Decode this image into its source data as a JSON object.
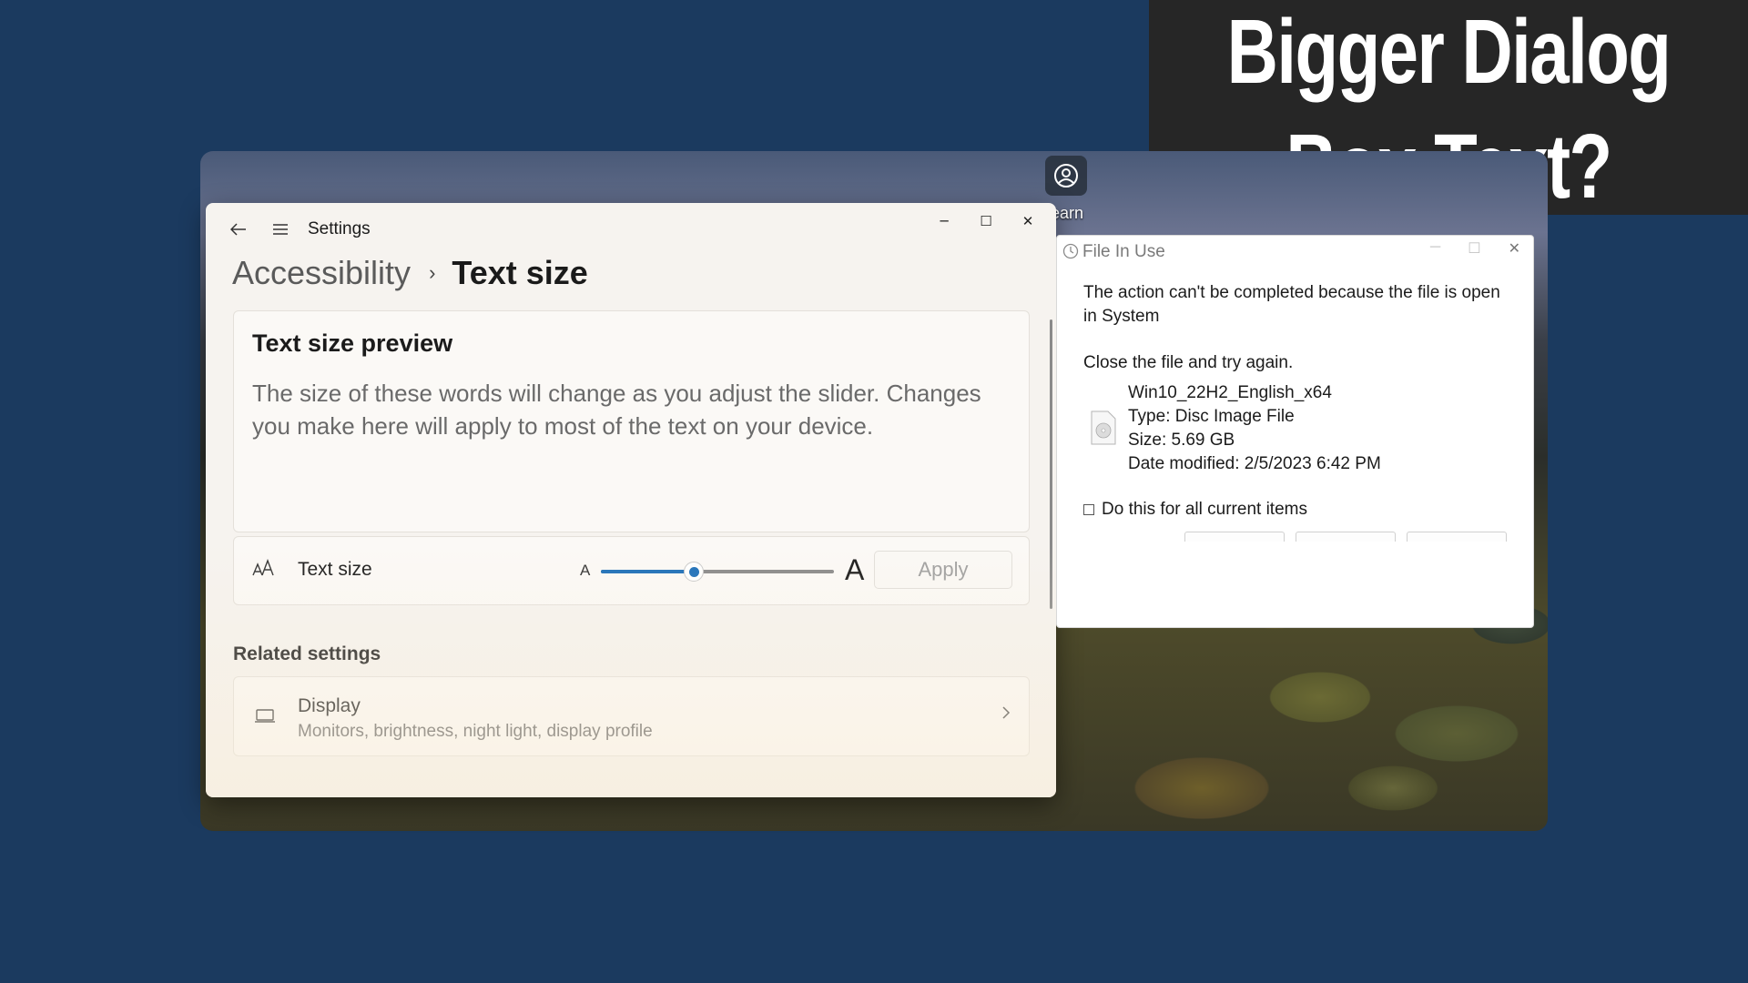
{
  "banner": {
    "line1": "Bigger Dialog",
    "line2": "Box Text?"
  },
  "desktop": {
    "icon_label": "earn",
    "icon": "user-circle-icon"
  },
  "settings": {
    "app_title": "Settings",
    "window_controls": {
      "minimize": "─",
      "maximize": "☐",
      "close": "✕"
    },
    "breadcrumb": {
      "parent": "Accessibility",
      "separator": "›",
      "current": "Text size"
    },
    "preview": {
      "heading": "Text size preview",
      "body": "The size of these words will change as you adjust the slider. Changes you make here will apply to most of the text on your device."
    },
    "text_size": {
      "label": "Text size",
      "small_a": "A",
      "large_a": "A",
      "slider_value_fraction": 0.4,
      "apply_label": "Apply"
    },
    "related": {
      "heading": "Related settings",
      "display": {
        "title": "Display",
        "subtitle": "Monitors, brightness, night light, display profile"
      }
    },
    "colors": {
      "accent": "#1d6fb8"
    }
  },
  "dialog": {
    "title": "File In Use",
    "message": "The action can't be completed because the file is open in System",
    "instruction": "Close the file and try again.",
    "file": {
      "name": "Win10_22H2_English_x64",
      "type": "Type: Disc Image File",
      "size": "Size: 5.69 GB",
      "modified": "Date modified: 2/5/2023 6:42 PM"
    },
    "checkbox_label": "Do this for all current items",
    "checkbox_checked": false
  }
}
